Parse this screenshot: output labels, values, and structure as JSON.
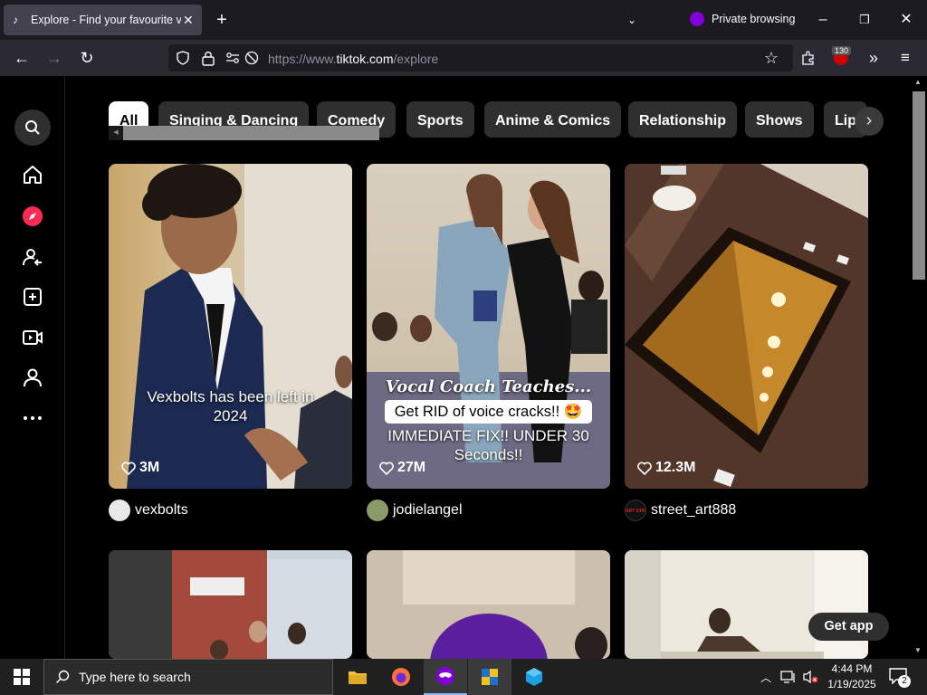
{
  "browser": {
    "tab_title": "Explore - Find your favourite vi",
    "new_tab": "+",
    "private_label": "Private browsing",
    "url_prefix": "https://www.",
    "url_domain": "tiktok.com",
    "url_path": "/explore",
    "extension_badge": "130"
  },
  "sidebar": {
    "items": [
      "search-icon",
      "home-icon",
      "explore-icon",
      "following-icon",
      "upload-icon",
      "live-icon",
      "profile-icon",
      "more-icon"
    ]
  },
  "categories": [
    "All",
    "Singing & Dancing",
    "Comedy",
    "Sports",
    "Anime & Comics",
    "Relationship",
    "Shows",
    "Lip"
  ],
  "videos": [
    {
      "caption": "Vexbolts has been left in 2024",
      "views": "3M",
      "username": "vexbolts"
    },
    {
      "caption_script": "Vocal Coach Teaches...",
      "caption_box": "Get RID of voice cracks!! 🤩",
      "caption_bottom": "IMMEDIATE FIX!! UNDER 30 Seconds!!",
      "views": "27M",
      "username": "jodielangel"
    },
    {
      "caption": "",
      "views": "12.3M",
      "username": "street_art888",
      "avatar_text": "ART STREETS"
    }
  ],
  "get_app": "Get app",
  "taskbar": {
    "search_placeholder": "Type here to search",
    "time": "4:44 PM",
    "date": "1/19/2025",
    "notifications": "2"
  },
  "colors": {
    "accent": "#fe2c55",
    "private": "#8000d7"
  }
}
